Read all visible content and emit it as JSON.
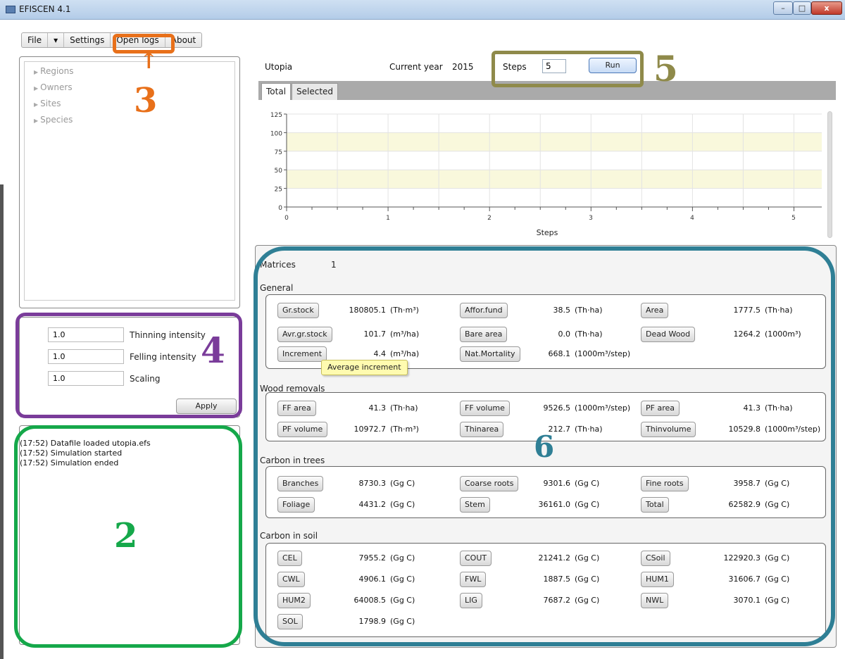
{
  "window": {
    "title": "EFISCEN 4.1",
    "controls": [
      "–",
      "□",
      "x"
    ]
  },
  "menu": [
    "File",
    "▾",
    "Settings",
    "Open logs",
    "About"
  ],
  "tree": [
    "Regions",
    "Owners",
    "Sites",
    "Species"
  ],
  "params": [
    {
      "value": "1.0",
      "label": "Thinning intensity"
    },
    {
      "value": "1.0",
      "label": "Felling intensity"
    },
    {
      "value": "1.0",
      "label": "Scaling"
    }
  ],
  "apply_label": "Apply",
  "log": [
    "(17:52) Datafile loaded utopia.efs",
    "(17:52) Simulation started",
    "(17:52) Simulation ended"
  ],
  "top": {
    "region": "Utopia",
    "current_year_label": "Current year",
    "current_year": "2015",
    "steps_label": "Steps",
    "steps_value": "5",
    "run_label": "Run"
  },
  "tabs": [
    "Total",
    "Selected"
  ],
  "chart_data": {
    "type": "line",
    "xlabel": "Steps",
    "yticks": [
      "125",
      "100",
      "75",
      "50",
      "25",
      "0"
    ],
    "xticks": [
      "0",
      "1",
      "2",
      "3",
      "4",
      "5"
    ],
    "ylim": [
      0,
      125
    ],
    "xlim": [
      0,
      5
    ],
    "grid": true,
    "bands": true
  },
  "matrices": {
    "label": "Matrices",
    "value": "1"
  },
  "sections": [
    {
      "title": "General",
      "rows": [
        [
          {
            "b": "Gr.stock",
            "v": "180805.1",
            "u": "(Th·m³)"
          },
          {
            "b": "Affor.fund",
            "v": "38.5",
            "u": "(Th·ha)"
          },
          {
            "b": "Area",
            "v": "1777.5",
            "u": "(Th·ha)"
          }
        ],
        [
          {
            "b": "Avr.gr.stock",
            "v": "101.7",
            "u": "(m³/ha)"
          },
          {
            "b": "Bare area",
            "v": "0.0",
            "u": "(Th·ha)"
          },
          {
            "b": "Dead Wood",
            "v": "1264.2",
            "u": "(1000m³)"
          }
        ],
        [
          {
            "b": "Increment",
            "v": "4.4",
            "u": "(m³/ha)"
          },
          {
            "b": "Nat.Mortality",
            "v": "668.1",
            "u": "(1000m³/step)"
          }
        ]
      ]
    },
    {
      "title": "Wood removals",
      "rows": [
        [
          {
            "b": "FF area",
            "v": "41.3",
            "u": "(Th·ha)"
          },
          {
            "b": "FF volume",
            "v": "9526.5",
            "u": "(1000m³/step)"
          },
          {
            "b": "PF area",
            "v": "41.3",
            "u": "(Th·ha)"
          }
        ],
        [
          {
            "b": "PF volume",
            "v": "10972.7",
            "u": "(Th·m³)"
          },
          {
            "b": "Thinarea",
            "v": "212.7",
            "u": "(Th·ha)"
          },
          {
            "b": "Thinvolume",
            "v": "10529.8",
            "u": "(1000m³/step)"
          }
        ]
      ]
    },
    {
      "title": "Carbon in trees",
      "rows": [
        [
          {
            "b": "Branches",
            "v": "8730.3",
            "u": "(Gg C)"
          },
          {
            "b": "Coarse roots",
            "v": "9301.6",
            "u": "(Gg C)"
          },
          {
            "b": "Fine roots",
            "v": "3958.7",
            "u": "(Gg C)"
          }
        ],
        [
          {
            "b": "Foliage",
            "v": "4431.2",
            "u": "(Gg C)"
          },
          {
            "b": "Stem",
            "v": "36161.0",
            "u": "(Gg C)"
          },
          {
            "b": "Total",
            "v": "62582.9",
            "u": "(Gg C)"
          }
        ]
      ]
    },
    {
      "title": "Carbon in soil",
      "rows": [
        [
          {
            "b": "CEL",
            "v": "7955.2",
            "u": "(Gg C)"
          },
          {
            "b": "COUT",
            "v": "21241.2",
            "u": "(Gg C)"
          },
          {
            "b": "CSoil",
            "v": "122920.3",
            "u": "(Gg C)"
          }
        ],
        [
          {
            "b": "CWL",
            "v": "4906.1",
            "u": "(Gg C)"
          },
          {
            "b": "FWL",
            "v": "1887.5",
            "u": "(Gg C)"
          },
          {
            "b": "HUM1",
            "v": "31606.7",
            "u": "(Gg C)"
          }
        ],
        [
          {
            "b": "HUM2",
            "v": "64008.5",
            "u": "(Gg C)"
          },
          {
            "b": "LIG",
            "v": "7687.2",
            "u": "(Gg C)"
          },
          {
            "b": "NWL",
            "v": "3070.1",
            "u": "(Gg C)"
          }
        ],
        [
          {
            "b": "SOL",
            "v": "1798.9",
            "u": "(Gg C)"
          }
        ]
      ]
    }
  ],
  "tooltip": "Average increment",
  "annotations": [
    {
      "label": "2",
      "color": "#15a84a"
    },
    {
      "label": "3",
      "color": "#e8701a"
    },
    {
      "label": "4",
      "color": "#7a3c9a"
    },
    {
      "label": "5",
      "color": "#8f8a4a"
    },
    {
      "label": "6",
      "color": "#2f7f95"
    }
  ]
}
